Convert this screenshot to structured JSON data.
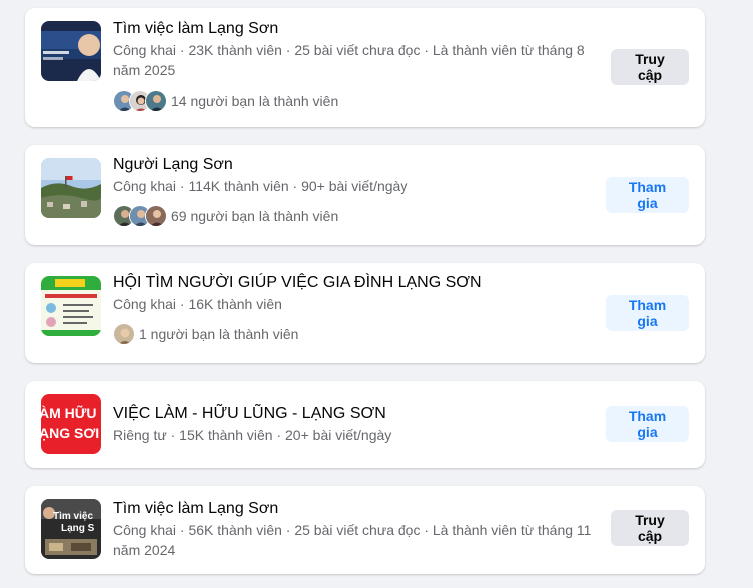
{
  "groups": [
    {
      "name": "Tìm việc làm Lạng Sơn",
      "meta": "Công khai · 23K thành viên · 25 bài viết chưa đọc · Là thành viên từ tháng 8 năm 2025",
      "friends": "14 người bạn là thành viên",
      "button": "Truy cập"
    },
    {
      "name": "Người Lạng Sơn",
      "meta": "Công khai · 114K thành viên · 90+ bài viết/ngày",
      "friends": "69 người bạn là thành viên",
      "button": "Tham gia"
    },
    {
      "name": "HỘI TÌM NGƯỜI GIÚP VIỆC GIA ĐÌNH LẠNG SƠN",
      "meta": "Công khai · 16K thành viên",
      "friends": "1 người bạn là thành viên",
      "button": "Tham gia"
    },
    {
      "name": "VIỆC LÀM - HỮU LŨNG - LẠNG SƠN",
      "meta": "Riêng tư · 15K thành viên · 20+ bài viết/ngày",
      "button": "Tham gia",
      "thumb_text": [
        "ÀM HỮU",
        "ẠNG SƠI"
      ]
    },
    {
      "name": "Tìm việc làm Lạng Sơn",
      "meta": "Công khai · 56K thành viên · 25 bài viết chưa đọc · Là thành viên từ tháng 11 năm 2024",
      "button": "Truy cập",
      "thumb_text": [
        "Tìm việc",
        "Lạng S"
      ]
    }
  ],
  "colors": {
    "page_bg": "#f0f2f5",
    "card_bg": "#ffffff",
    "primary_text": "#050505",
    "secondary_text": "#65676b",
    "join_button_bg": "#ebf5ff",
    "join_button_text": "#1877f2",
    "visit_button_bg": "#e4e6eb"
  }
}
